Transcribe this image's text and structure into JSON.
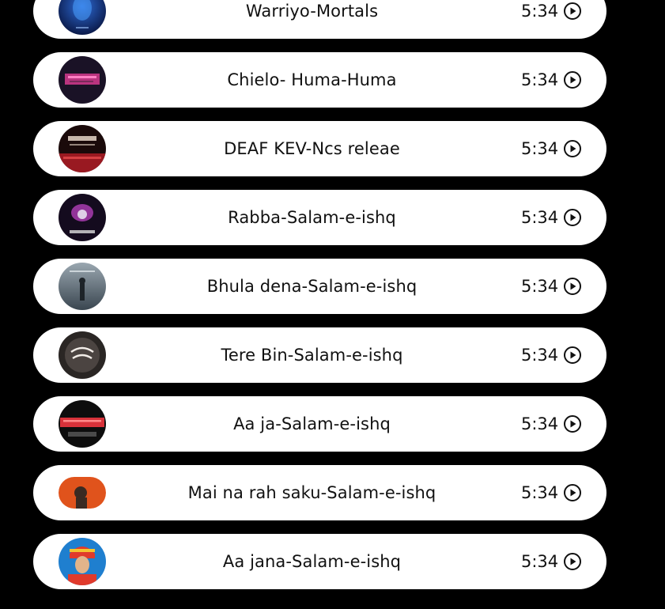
{
  "songs": [
    {
      "title": "Warriyo-Mortals",
      "duration": "5:34",
      "cover_colors": [
        "#0b1a4a",
        "#2d6bd6"
      ]
    },
    {
      "title": "Chielo- Huma-Huma",
      "duration": "5:34",
      "cover_colors": [
        "#1a1226",
        "#d63b8f"
      ]
    },
    {
      "title": "DEAF KEV-Ncs releae",
      "duration": "5:34",
      "cover_colors": [
        "#1a0a0a",
        "#c41f2a"
      ]
    },
    {
      "title": "Rabba-Salam-e-ishq",
      "duration": "5:34",
      "cover_colors": [
        "#140b1e",
        "#b23fb8"
      ]
    },
    {
      "title": "Bhula dena-Salam-e-ishq",
      "duration": "5:34",
      "cover_colors": [
        "#3a4650",
        "#9aa7b0"
      ]
    },
    {
      "title": "Tere Bin-Salam-e-ishq",
      "duration": "5:34",
      "cover_colors": [
        "#2a2624",
        "#8a7f78"
      ]
    },
    {
      "title": "Aa ja-Salam-e-ishq",
      "duration": "5:34",
      "cover_colors": [
        "#0d0d0d",
        "#d8323a"
      ]
    },
    {
      "title": "Mai na rah saku-Salam-e-ishq",
      "duration": "5:34",
      "cover_colors": [
        "#e0531c",
        "#3a2a22"
      ]
    },
    {
      "title": "Aa jana-Salam-e-ishq",
      "duration": "5:34",
      "cover_colors": [
        "#1f7fcf",
        "#e03a2c"
      ]
    }
  ],
  "icons": {
    "play": "play-circle-icon",
    "cover": "album-cover"
  }
}
